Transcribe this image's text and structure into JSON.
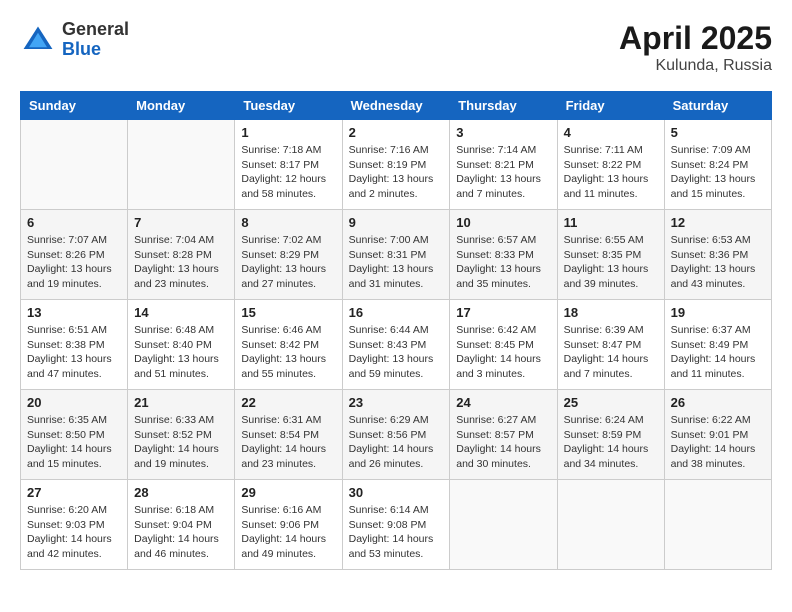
{
  "header": {
    "logo_general": "General",
    "logo_blue": "Blue",
    "month": "April 2025",
    "location": "Kulunda, Russia"
  },
  "weekdays": [
    "Sunday",
    "Monday",
    "Tuesday",
    "Wednesday",
    "Thursday",
    "Friday",
    "Saturday"
  ],
  "weeks": [
    [
      {
        "day": "",
        "info": ""
      },
      {
        "day": "",
        "info": ""
      },
      {
        "day": "1",
        "info": "Sunrise: 7:18 AM\nSunset: 8:17 PM\nDaylight: 12 hours and 58 minutes."
      },
      {
        "day": "2",
        "info": "Sunrise: 7:16 AM\nSunset: 8:19 PM\nDaylight: 13 hours and 2 minutes."
      },
      {
        "day": "3",
        "info": "Sunrise: 7:14 AM\nSunset: 8:21 PM\nDaylight: 13 hours and 7 minutes."
      },
      {
        "day": "4",
        "info": "Sunrise: 7:11 AM\nSunset: 8:22 PM\nDaylight: 13 hours and 11 minutes."
      },
      {
        "day": "5",
        "info": "Sunrise: 7:09 AM\nSunset: 8:24 PM\nDaylight: 13 hours and 15 minutes."
      }
    ],
    [
      {
        "day": "6",
        "info": "Sunrise: 7:07 AM\nSunset: 8:26 PM\nDaylight: 13 hours and 19 minutes."
      },
      {
        "day": "7",
        "info": "Sunrise: 7:04 AM\nSunset: 8:28 PM\nDaylight: 13 hours and 23 minutes."
      },
      {
        "day": "8",
        "info": "Sunrise: 7:02 AM\nSunset: 8:29 PM\nDaylight: 13 hours and 27 minutes."
      },
      {
        "day": "9",
        "info": "Sunrise: 7:00 AM\nSunset: 8:31 PM\nDaylight: 13 hours and 31 minutes."
      },
      {
        "day": "10",
        "info": "Sunrise: 6:57 AM\nSunset: 8:33 PM\nDaylight: 13 hours and 35 minutes."
      },
      {
        "day": "11",
        "info": "Sunrise: 6:55 AM\nSunset: 8:35 PM\nDaylight: 13 hours and 39 minutes."
      },
      {
        "day": "12",
        "info": "Sunrise: 6:53 AM\nSunset: 8:36 PM\nDaylight: 13 hours and 43 minutes."
      }
    ],
    [
      {
        "day": "13",
        "info": "Sunrise: 6:51 AM\nSunset: 8:38 PM\nDaylight: 13 hours and 47 minutes."
      },
      {
        "day": "14",
        "info": "Sunrise: 6:48 AM\nSunset: 8:40 PM\nDaylight: 13 hours and 51 minutes."
      },
      {
        "day": "15",
        "info": "Sunrise: 6:46 AM\nSunset: 8:42 PM\nDaylight: 13 hours and 55 minutes."
      },
      {
        "day": "16",
        "info": "Sunrise: 6:44 AM\nSunset: 8:43 PM\nDaylight: 13 hours and 59 minutes."
      },
      {
        "day": "17",
        "info": "Sunrise: 6:42 AM\nSunset: 8:45 PM\nDaylight: 14 hours and 3 minutes."
      },
      {
        "day": "18",
        "info": "Sunrise: 6:39 AM\nSunset: 8:47 PM\nDaylight: 14 hours and 7 minutes."
      },
      {
        "day": "19",
        "info": "Sunrise: 6:37 AM\nSunset: 8:49 PM\nDaylight: 14 hours and 11 minutes."
      }
    ],
    [
      {
        "day": "20",
        "info": "Sunrise: 6:35 AM\nSunset: 8:50 PM\nDaylight: 14 hours and 15 minutes."
      },
      {
        "day": "21",
        "info": "Sunrise: 6:33 AM\nSunset: 8:52 PM\nDaylight: 14 hours and 19 minutes."
      },
      {
        "day": "22",
        "info": "Sunrise: 6:31 AM\nSunset: 8:54 PM\nDaylight: 14 hours and 23 minutes."
      },
      {
        "day": "23",
        "info": "Sunrise: 6:29 AM\nSunset: 8:56 PM\nDaylight: 14 hours and 26 minutes."
      },
      {
        "day": "24",
        "info": "Sunrise: 6:27 AM\nSunset: 8:57 PM\nDaylight: 14 hours and 30 minutes."
      },
      {
        "day": "25",
        "info": "Sunrise: 6:24 AM\nSunset: 8:59 PM\nDaylight: 14 hours and 34 minutes."
      },
      {
        "day": "26",
        "info": "Sunrise: 6:22 AM\nSunset: 9:01 PM\nDaylight: 14 hours and 38 minutes."
      }
    ],
    [
      {
        "day": "27",
        "info": "Sunrise: 6:20 AM\nSunset: 9:03 PM\nDaylight: 14 hours and 42 minutes."
      },
      {
        "day": "28",
        "info": "Sunrise: 6:18 AM\nSunset: 9:04 PM\nDaylight: 14 hours and 46 minutes."
      },
      {
        "day": "29",
        "info": "Sunrise: 6:16 AM\nSunset: 9:06 PM\nDaylight: 14 hours and 49 minutes."
      },
      {
        "day": "30",
        "info": "Sunrise: 6:14 AM\nSunset: 9:08 PM\nDaylight: 14 hours and 53 minutes."
      },
      {
        "day": "",
        "info": ""
      },
      {
        "day": "",
        "info": ""
      },
      {
        "day": "",
        "info": ""
      }
    ]
  ]
}
